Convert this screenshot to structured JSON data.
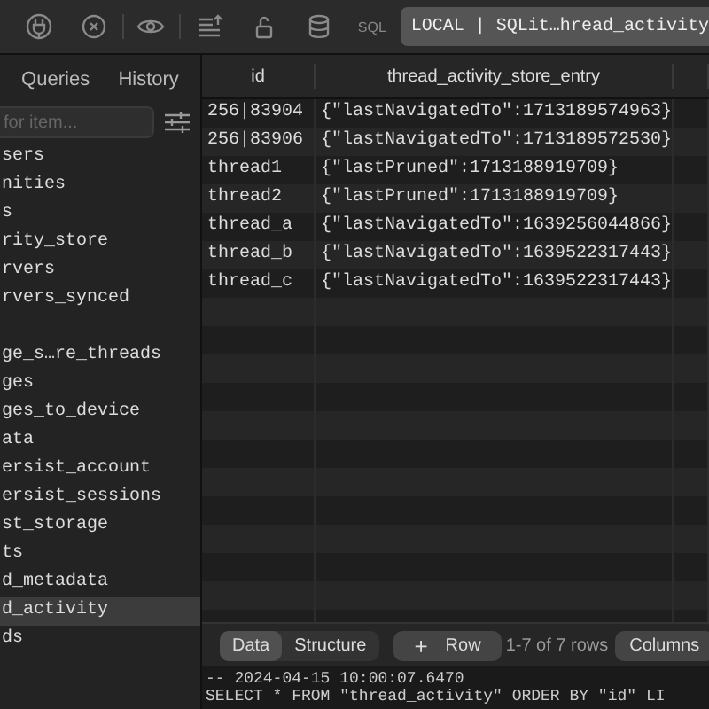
{
  "toolbar": {
    "sql_label": "SQL",
    "connection": "LOCAL | SQLit…hread_activity"
  },
  "sidebar": {
    "tabs": [
      {
        "label": "Queries",
        "selected": false
      },
      {
        "label": "History",
        "selected": false
      }
    ],
    "search": {
      "placeholder": "for item..."
    },
    "groups": [
      [
        {
          "label": "sers",
          "selected": false
        },
        {
          "label": "nities",
          "selected": false
        },
        {
          "label": "s",
          "selected": false
        },
        {
          "label": "rity_store",
          "selected": false
        },
        {
          "label": "rvers",
          "selected": false
        },
        {
          "label": "rvers_synced",
          "selected": false
        }
      ],
      [
        {
          "label": "ge_s…re_threads",
          "selected": false
        },
        {
          "label": "ges",
          "selected": false
        },
        {
          "label": "ges_to_device",
          "selected": false
        },
        {
          "label": "ata",
          "selected": false
        },
        {
          "label": "ersist_account",
          "selected": false
        },
        {
          "label": "ersist_sessions",
          "selected": false
        },
        {
          "label": "st_storage",
          "selected": false
        },
        {
          "label": "ts",
          "selected": false
        },
        {
          "label": "d_metadata",
          "selected": false
        },
        {
          "label": "d_activity",
          "selected": true
        },
        {
          "label": "ds",
          "selected": false
        }
      ]
    ]
  },
  "table": {
    "columns": [
      "id",
      "thread_activity_store_entry"
    ],
    "rows": [
      [
        "256|83904",
        "{\"lastNavigatedTo\":1713189574963}"
      ],
      [
        "256|83906",
        "{\"lastNavigatedTo\":1713189572530}"
      ],
      [
        "thread1",
        "{\"lastPruned\":1713188919709}"
      ],
      [
        "thread2",
        "{\"lastPruned\":1713188919709}"
      ],
      [
        "thread_a",
        "{\"lastNavigatedTo\":1639256044866}"
      ],
      [
        "thread_b",
        "{\"lastNavigatedTo\":1639522317443}"
      ],
      [
        "thread_c",
        "{\"lastNavigatedTo\":1639522317443}"
      ]
    ]
  },
  "bottom_bar": {
    "view_tabs": [
      {
        "label": "Data",
        "selected": true
      },
      {
        "label": "Structure",
        "selected": false
      }
    ],
    "add_row": {
      "icon": "+",
      "label": "Row"
    },
    "count": "1-7 of 7 rows",
    "columns_button": "Columns"
  },
  "log": [
    "-- 2024-04-15 10:00:07.6470",
    "SELECT * FROM  \"thread_activity\" ORDER BY \"id\" LI"
  ]
}
